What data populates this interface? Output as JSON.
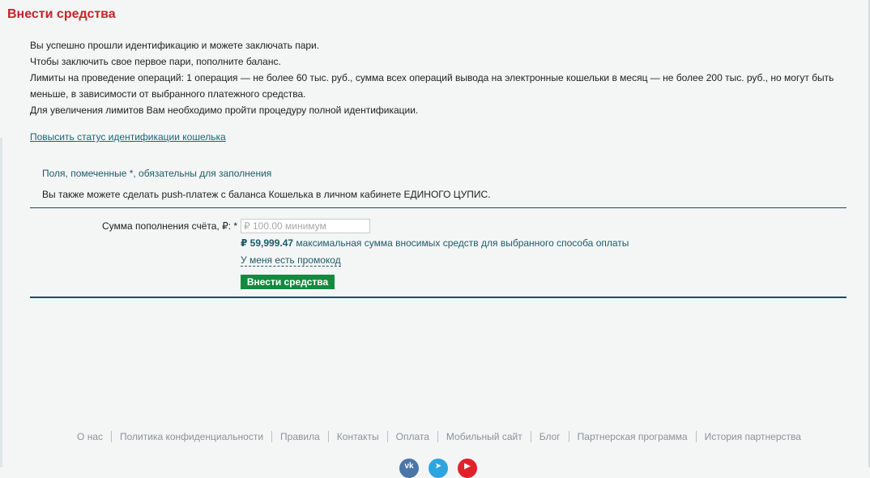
{
  "page": {
    "title": "Внести средства"
  },
  "intro": {
    "lines": [
      "Вы успешно прошли идентификацию и можете заключать пари.",
      "Чтобы заключить свое первое пари, пополните баланс.",
      "Лимиты на проведение операций: 1 операция — не более 60 тыс. руб., сумма всех операций вывода на электронные кошельки в месяц — не более 200 тыс. руб., но могут быть меньше, в зависимости от выбранного платежного средства.",
      "Для увеличения лимитов Вам необходимо пройти процедуру полной идентификации."
    ],
    "upgrade_link": "Повысить статус идентификации кошелька"
  },
  "form": {
    "required_note": "Поля, помеченные *, обязательны для заполнения",
    "push_note": "Вы также можете сделать push-платеж с баланса Кошелька в личном кабинете ЕДИНОГО ЦУПИС.",
    "amount_label": "Сумма пополнения счёта, ₽: *",
    "amount_placeholder": "₽ 100.00 минимум",
    "amount_value": "",
    "max_amount": "₽ 59,999.47",
    "max_amount_text": "максимальная сумма вносимых средств для выбранного способа оплаты",
    "promo_link": "У меня есть промокод",
    "submit_label": "Внести средства"
  },
  "footer": {
    "links": [
      "О нас",
      "Политика конфиденциальности",
      "Правила",
      "Контакты",
      "Оплата",
      "Мобильный сайт",
      "Блог",
      "Партнерская программа",
      "История партнерства"
    ],
    "social": [
      {
        "icon": "vk-icon",
        "glyph": "vk",
        "color": "#4a76a8"
      },
      {
        "icon": "telegram-icon",
        "glyph": "➤",
        "color": "#2ca5e0"
      },
      {
        "icon": "youtube-icon",
        "glyph": "▶",
        "color": "#e0222a"
      }
    ]
  },
  "colors": {
    "title": "#c4242a",
    "accent": "#1d5a66",
    "button": "#148a3f",
    "rule": "#134f5c"
  }
}
